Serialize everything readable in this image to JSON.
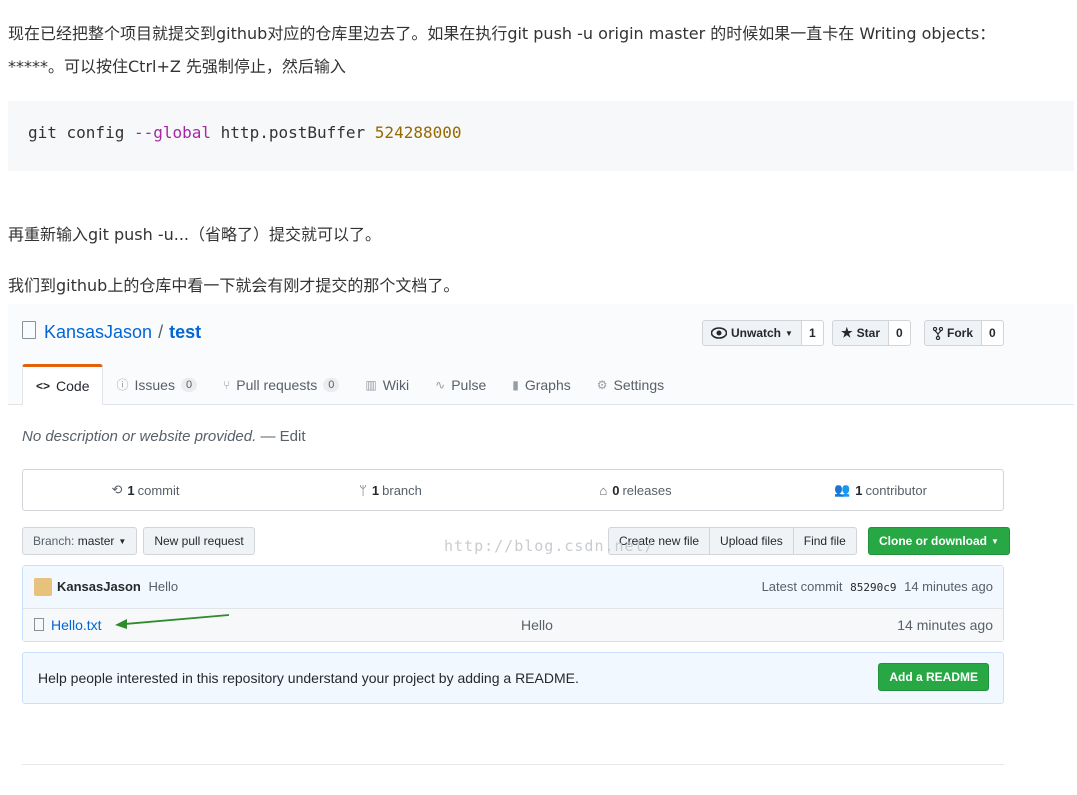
{
  "article": {
    "para1_line1": "现在已经把整个项目就提交到github对应的仓库里边去了。如果在执行git  push -u origin master 的时候如果一直卡在 Writing objects：",
    "para1_line2": "*****。可以按住Ctrl+Z 先强制停止，然后输入",
    "code": {
      "cmd": "git config ",
      "flag": "--global",
      "key": " http.postBuffer ",
      "value": "524288000"
    },
    "para2": "再重新输入git push -u...（省略了）提交就可以了。",
    "para3": "我们到github上的仓库中看一下就会有刚才提交的那个文档了。"
  },
  "github": {
    "owner": "KansasJason",
    "separator": "/",
    "repo": "test",
    "unwatch_label": "Unwatch",
    "unwatch_count": "1",
    "star_label": "Star",
    "star_count": "0",
    "fork_label": "Fork",
    "fork_count": "0",
    "tabs": [
      {
        "label": "Code",
        "icon": "<>"
      },
      {
        "label": "Issues",
        "badge": "0",
        "icon": "issue-icon"
      },
      {
        "label": "Pull requests",
        "badge": "0",
        "icon": "pull-request-icon"
      },
      {
        "label": "Wiki",
        "icon": "book-icon"
      },
      {
        "label": "Pulse",
        "icon": "pulse-icon"
      },
      {
        "label": "Graphs",
        "icon": "graph-icon"
      },
      {
        "label": "Settings",
        "icon": "gear-icon"
      }
    ],
    "description": "No description or website provided.",
    "edit_label": "— Edit",
    "summary": {
      "commits_num": "1",
      "commits_label": "commit",
      "branches_num": "1",
      "branches_label": "branch",
      "releases_num": "0",
      "releases_label": "releases",
      "contributors_num": "1",
      "contributors_label": "contributor"
    },
    "branch_prefix": "Branch:",
    "branch_name": "master",
    "new_pr_label": "New pull request",
    "create_file_label": "Create new file",
    "upload_label": "Upload files",
    "find_label": "Find file",
    "clone_label": "Clone or download",
    "watermark": "http://blog.csdn.net/",
    "commit": {
      "author": "KansasJason",
      "message": "Hello",
      "latest_label": "Latest commit",
      "sha": "85290c9",
      "age": "14 minutes ago"
    },
    "files": [
      {
        "name": "Hello.txt",
        "message": "Hello",
        "age": "14 minutes ago"
      }
    ],
    "readme_text": "Help people interested in this repository understand your project by adding a README.",
    "readme_button": "Add a README",
    "colors": {
      "accent": "#0366d6",
      "green": "#28a745",
      "tab_active_border": "#e36209",
      "arrow": "#2e8b2e"
    }
  }
}
